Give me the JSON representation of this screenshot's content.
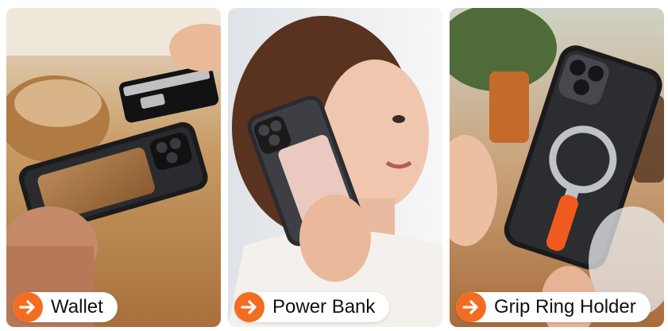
{
  "colors": {
    "accent": "#f26d21",
    "pill_bg": "#ffffff",
    "label_text": "#111111"
  },
  "cards": [
    {
      "label": "Wallet",
      "icon": "arrow-right-icon"
    },
    {
      "label": "Power Bank",
      "icon": "arrow-right-icon"
    },
    {
      "label": "Grip Ring Holder",
      "icon": "arrow-right-icon"
    }
  ]
}
